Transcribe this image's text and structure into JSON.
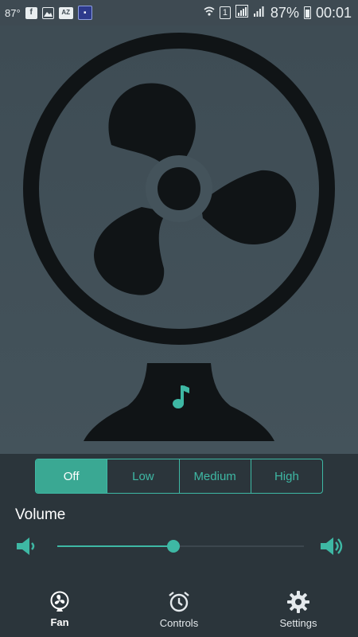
{
  "status_bar": {
    "temperature": "87°",
    "battery_percent": "87%",
    "time": "00:01",
    "sim_slot": "1",
    "notification_icons": [
      "facebook-icon",
      "gallery-icon",
      "az-icon",
      "book-icon"
    ]
  },
  "fan": {
    "music_icon": "music-note-icon"
  },
  "speed": {
    "options": [
      "Off",
      "Low",
      "Medium",
      "High"
    ],
    "selected": "Off"
  },
  "volume": {
    "label": "Volume",
    "level": 0.47
  },
  "nav": {
    "items": [
      {
        "label": "Fan",
        "icon": "fan-icon",
        "active": true
      },
      {
        "label": "Controls",
        "icon": "alarm-clock-icon",
        "active": false
      },
      {
        "label": "Settings",
        "icon": "gear-icon",
        "active": false
      }
    ]
  },
  "colors": {
    "accent": "#3eb8a4",
    "fan_area": "#44535b",
    "controls_bg": "#2b353b",
    "fan_shape": "#101416"
  }
}
